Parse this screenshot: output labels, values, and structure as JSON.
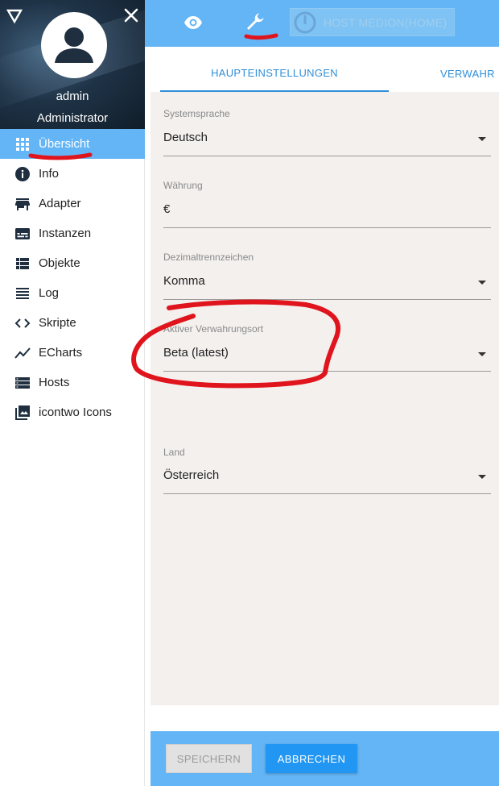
{
  "sidebar": {
    "user_name": "admin",
    "user_role": "Administrator",
    "items": [
      {
        "label": "Übersicht",
        "icon": "apps-grid-icon",
        "active": true
      },
      {
        "label": "Info",
        "icon": "info-icon"
      },
      {
        "label": "Adapter",
        "icon": "store-icon"
      },
      {
        "label": "Instanzen",
        "icon": "subtitles-icon"
      },
      {
        "label": "Objekte",
        "icon": "list-view-icon"
      },
      {
        "label": "Log",
        "icon": "lines-icon"
      },
      {
        "label": "Skripte",
        "icon": "code-icon"
      },
      {
        "label": "ECharts",
        "icon": "trend-chart-icon"
      },
      {
        "label": "Hosts",
        "icon": "storage-icon"
      },
      {
        "label": "icontwo Icons",
        "icon": "image-gallery-icon"
      }
    ]
  },
  "topbar": {
    "host_label": "HOST MEDION(HOME)"
  },
  "tabs": [
    {
      "label": "HAUPTEINSTELLUNGEN",
      "active": true
    },
    {
      "label": "VERWAHR"
    }
  ],
  "fields": {
    "systemsprache": {
      "label": "Systemsprache",
      "value": "Deutsch"
    },
    "waehrung": {
      "label": "Währung",
      "value": "€"
    },
    "dezimal": {
      "label": "Dezimaltrennzeichen",
      "value": "Komma"
    },
    "verwahrungsort": {
      "label": "Aktiver Verwahrungsort",
      "value": "Beta (latest)"
    },
    "land": {
      "label": "Land",
      "value": "Österreich"
    }
  },
  "footer": {
    "save_label": "SPEICHERN",
    "cancel_label": "ABBRECHEN"
  },
  "colors": {
    "accent": "#64b5f6",
    "primary_button": "#2196f3",
    "annotation": "#e0141c"
  }
}
